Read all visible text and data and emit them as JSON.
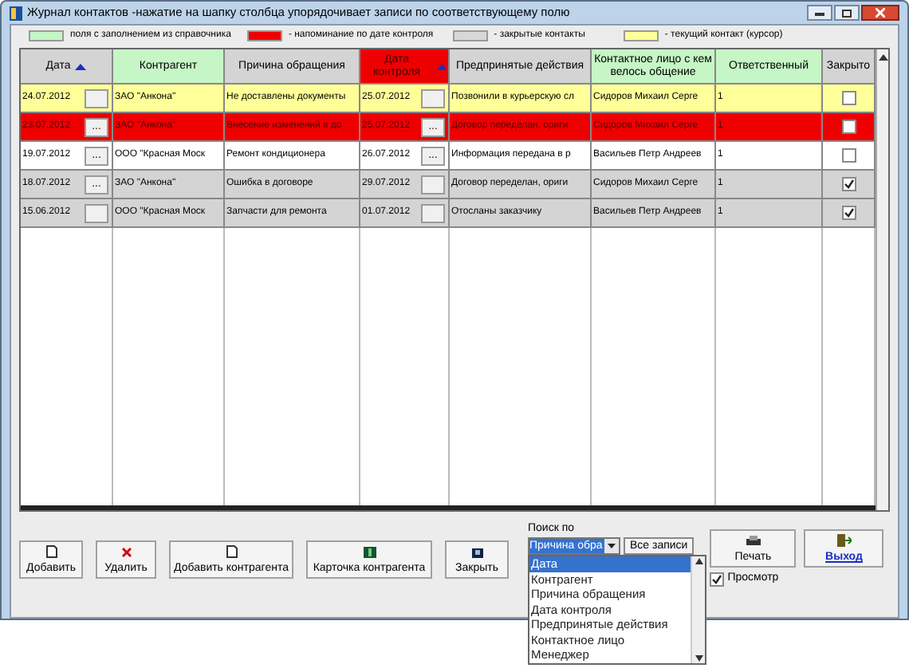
{
  "window": {
    "title": "Журнал контактов -нажатие на шапку столбца упорядочивает записи по соответствующему полю"
  },
  "legend": [
    {
      "color": "#c6f5c6",
      "label": "поля с заполнением из справочника"
    },
    {
      "color": "#ee0000",
      "label": "- напоминание по дате контроля"
    },
    {
      "color": "#d8d8d8",
      "label": "- закрытые контакты"
    },
    {
      "color": "#ffff99",
      "label": "- текущий контакт (курсор)"
    }
  ],
  "table": {
    "columns": [
      {
        "label": "Дата",
        "color": "#d4d4d4",
        "sorted": true
      },
      {
        "label": "Контрагент",
        "color": "#c6f5c6",
        "sorted": false
      },
      {
        "label": "Причина обращения",
        "color": "#d4d4d4",
        "sorted": false
      },
      {
        "label": "Дата контроля",
        "color": "#ee0000",
        "sorted": true
      },
      {
        "label": "Предпринятые действия",
        "color": "#d4d4d4",
        "sorted": false
      },
      {
        "label": "Контактное лицо с кем велось общение",
        "color": "#c6f5c6",
        "sorted": false
      },
      {
        "label": "Ответственный",
        "color": "#c6f5c6",
        "sorted": false
      },
      {
        "label": "Закрыто",
        "color": "#d4d4d4",
        "sorted": false
      }
    ],
    "rows": [
      {
        "kind": "current",
        "date": "24.07.2012",
        "counterparty": "ЗАО \"Анкона\"",
        "reason": "Не доставлены документы",
        "control": "25.07.2012",
        "actions": "Позвонили в курьерскую сл",
        "contact": "Сидоров Михаил Серге",
        "manager": "1",
        "closed": false
      },
      {
        "kind": "reminder",
        "date": "23.07.2012",
        "date_btn": "...",
        "counterparty": "ЗАО \"Анкона\"",
        "reason": "Внесение изменений в до",
        "control": "25.07.2012",
        "control_btn": "...",
        "actions": "Договор переделан, ориги",
        "contact": "Сидоров Михаил Серге",
        "manager": "1",
        "closed": false
      },
      {
        "kind": "open",
        "date": "19.07.2012",
        "date_btn": "...",
        "counterparty": "ООО \"Красная Моск",
        "reason": "Ремонт кондиционера",
        "control": "26.07.2012",
        "control_btn": "...",
        "actions": "Информация передана в р",
        "contact": "Васильев Петр Андреев",
        "manager": "1",
        "closed": false
      },
      {
        "kind": "closed",
        "date": "18.07.2012",
        "date_btn": "...",
        "counterparty": "ЗАО \"Анкона\"",
        "reason": "Ошибка в договоре",
        "control": "29.07.2012",
        "actions": "Договор переделан, ориги",
        "contact": "Сидоров Михаил Серге",
        "manager": "1",
        "closed": true
      },
      {
        "kind": "closed",
        "date": "15.06.2012",
        "counterparty": "ООО \"Красная Моск",
        "reason": "Запчасти для ремонта",
        "control": "01.07.2012",
        "actions": "Отосланы заказчику",
        "contact": "Васильев Петр Андреев",
        "manager": "1",
        "closed": true
      }
    ]
  },
  "buttons": [
    {
      "label": "Добавить"
    },
    {
      "label": "Удалить"
    },
    {
      "label": "Добавить контрагента"
    },
    {
      "label": "Карточка контрагента"
    },
    {
      "label": "Закрыть"
    }
  ],
  "search": {
    "label": "Поиск по",
    "value": "Причина обра",
    "all_button": "Все записи",
    "options": [
      {
        "label": "Дата",
        "selected": true
      },
      {
        "label": "Контрагент",
        "selected": false
      },
      {
        "label": "Причина обращения",
        "selected": false
      },
      {
        "label": "Дата контроля",
        "selected": false
      },
      {
        "label": "Предпринятые действия",
        "selected": false
      },
      {
        "label": "Контактное лицо",
        "selected": false
      },
      {
        "label": "Менеджер",
        "selected": false
      }
    ]
  },
  "print": {
    "label": "Печать",
    "preview_label": "Просмотр",
    "preview_checked": true
  },
  "exit": {
    "label": "Выход"
  }
}
